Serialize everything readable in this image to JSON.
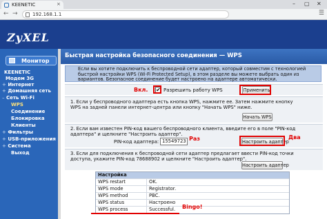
{
  "browser": {
    "tab_title": "KEENETIC",
    "tab_close": "×",
    "minimize": "–",
    "maximize": "▢",
    "close": "✕",
    "back": "←",
    "forward": "→",
    "url": "192.168.1.1",
    "menu": "☰"
  },
  "header": {
    "logo": "ZyXEL"
  },
  "sidebar": {
    "monitor_label": "Монитор",
    "device": "KEENETIC",
    "items": [
      {
        "marker": "",
        "label": "Модем 3G"
      },
      {
        "marker": "+",
        "label": "Интернет"
      },
      {
        "marker": "+",
        "label": "Домашняя сеть"
      },
      {
        "marker": "–",
        "label": "Сеть Wi-Fi"
      },
      {
        "marker": "",
        "label": "WPS"
      },
      {
        "marker": "",
        "label": "Соединение"
      },
      {
        "marker": "",
        "label": "Блокировка"
      },
      {
        "marker": "",
        "label": "Клиенты"
      },
      {
        "marker": "+",
        "label": "Фильтры"
      },
      {
        "marker": "+",
        "label": "USB-приложения"
      },
      {
        "marker": "+",
        "label": "Система"
      },
      {
        "marker": "",
        "label": "Выход"
      }
    ]
  },
  "main": {
    "title": "Быстрая настройка безопасного соединения — WPS",
    "info": "Если вы хотите подключить к беспроводной сети адаптер, который совместим с технологией быстрой настройки WPS (Wi-Fi Protected Setup), в этом разделе вы можете выбрать один из вариантов. Безопасное соединение будет настроено на адаптере автоматически.",
    "enable_label": "Разрешить работу WPS",
    "enable_checked": "✔",
    "apply_button": "Применить",
    "step1": "1. Если у беспроводного адаптера есть кнопка WPS, нажмите ее. Затем нажмите кнопку WPS на задней панели интернет-центра или кнопку \"Начать WPS\" ниже.",
    "start_wps_button": "Начать WPS",
    "step2": "2. Если вам известен PIN-код вашего беспроводного клиента, введите его в поле \"PIN-код адаптера\" и щелкните \"Настроить адаптер\".",
    "pin_label": "PIN-код адаптера:",
    "pin_value": "15549723",
    "configure_button_1": "Настроить адаптер",
    "step3": "3. Если для подключения к беспроводной сети адаптер предлагает ввести PIN-код точки доступа, укажите PIN-код 78688902 и щелкните \"Настроить адаптер\".",
    "configure_button_2": "Настроить адаптер",
    "status": {
      "header": "Настройка",
      "rows": [
        {
          "key": "WPS restart",
          "value": "OK."
        },
        {
          "key": "WPS mode",
          "value": "Registrator."
        },
        {
          "key": "WPS method",
          "value": "PBC."
        },
        {
          "key": "WPS status",
          "value": "Настроено"
        },
        {
          "key": "WPS process",
          "value": "Successful."
        }
      ]
    }
  },
  "annotations": {
    "enabled": "Вкл.",
    "pin_hint": "Раз",
    "two": "Два",
    "bingo": "Bingo!"
  }
}
